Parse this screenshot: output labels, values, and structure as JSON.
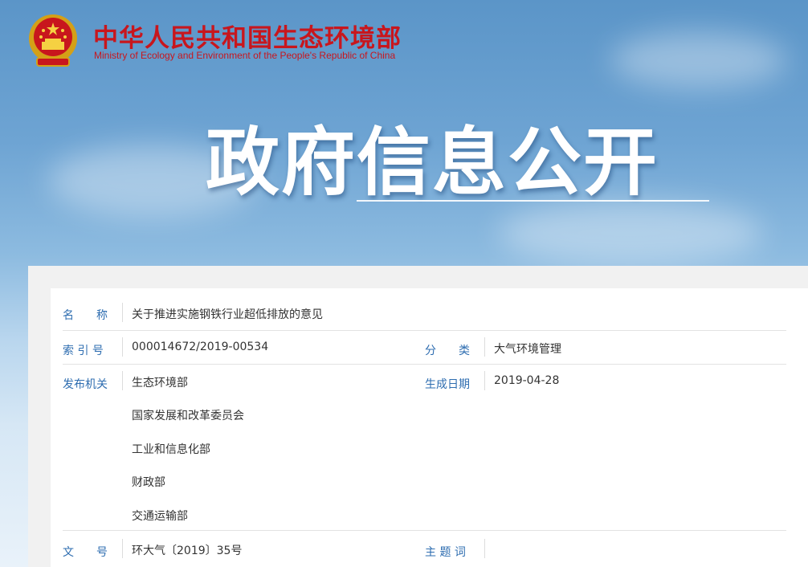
{
  "site": {
    "title_cn": "中华人民共和国生态环境部",
    "title_en": "Ministry of Ecology and Environment of the People's Republic of China"
  },
  "banner": {
    "title": "政府信息公开"
  },
  "colors": {
    "brand_red": "#c8161d",
    "label_blue": "#2e6db0",
    "text": "#333333"
  },
  "info": {
    "name_label": "名　　称",
    "name_value": "关于推进实施钢铁行业超低排放的意见",
    "index_label": "索 引 号",
    "index_value": "000014672/2019-00534",
    "category_label": "分　　类",
    "category_value": "大气环境管理",
    "issuer_label": "发布机关",
    "issuers": [
      "生态环境部",
      "国家发展和改革委员会",
      "工业和信息化部",
      "财政部",
      "交通运输部"
    ],
    "date_label": "生成日期",
    "date_value": "2019-04-28",
    "doc_no_label": "文　　号",
    "doc_no_value": "环大气〔2019〕35号",
    "keywords_label": "主 题 词",
    "keywords_value": ""
  }
}
